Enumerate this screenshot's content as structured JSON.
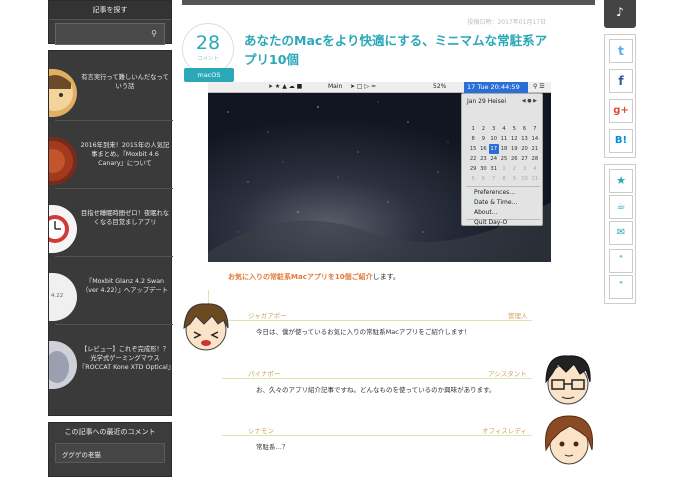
{
  "sidebar": {
    "search_title": "記事を探す",
    "articles": [
      {
        "title": "有言実行って難しいんだなっていう話"
      },
      {
        "title": "2016年到来！2015年の人気記事まとめ。『Moxbit 4.6 Canary』について"
      },
      {
        "title": "目指せ睡眠時間ゼロ！夜眠れなくなる目覚ましアプリ"
      },
      {
        "title": "『Moxbit Glanz 4.2 Swan（ver 4.22）』へアップデート",
        "thumb_label": "4.22"
      },
      {
        "title": "【レビュー】これぞ完成形！？光学式ゲーミングマウス『ROCCAT Kone XTD Optical』"
      }
    ],
    "comments_title": "この記事への最近のコメント",
    "comment_author": "ググゲの老猫"
  },
  "article": {
    "post_date": "投稿日時：2017年01月17日",
    "comment_count": "28",
    "comment_label": "コメント",
    "category": "macOS",
    "title": "あなたのMacをより快適にする、ミニマムな常駐系アプリ10個",
    "intro_highlight": "お気に入りの常駐系Macアプリを10個ご紹介",
    "intro_rest": "します。"
  },
  "screenshot": {
    "menu_main": "Main",
    "battery": "52%",
    "clock": "17 Tue 20:44:59",
    "cal_month": "Jan 29 Heisei",
    "cal_nav": "◀ ● ▶",
    "cal_rows": [
      [
        "",
        "",
        "",
        "",
        "",
        "",
        ""
      ],
      [
        "1",
        "2",
        "3",
        "4",
        "5",
        "6",
        "7"
      ],
      [
        "8",
        "9",
        "10",
        "11",
        "12",
        "13",
        "14"
      ],
      [
        "15",
        "16",
        "17",
        "18",
        "19",
        "20",
        "21"
      ],
      [
        "22",
        "23",
        "24",
        "25",
        "26",
        "27",
        "28"
      ],
      [
        "29",
        "30",
        "31",
        "1",
        "2",
        "3",
        "4"
      ],
      [
        "5",
        "6",
        "7",
        "8",
        "9",
        "10",
        "11"
      ]
    ],
    "menu_preferences": "Preferences...",
    "menu_datetime": "Date & Time...",
    "menu_about": "About...",
    "menu_quit": "Quit Day-O"
  },
  "dialogs": [
    {
      "speaker": "ジャガアポー",
      "role": "管理人",
      "message": "今日は、僕が使っているお気に入りの常駐系Macアプリをご紹介します！"
    },
    {
      "speaker": "パイナポー",
      "role": "アシスタント",
      "message": "お、久々のアプリ紹介記事ですね。どんなものを使っているのか興味があります。"
    },
    {
      "speaker": "シナモン",
      "role": "オフィスレディ",
      "message": "常駐系…？"
    }
  ],
  "social": {
    "twitter": "t",
    "facebook": "f",
    "gplus": "g+",
    "hatena": "B!"
  },
  "colors": {
    "accent": "#2aa8b8",
    "sidebar": "#3a3a3a",
    "highlight": "#e07b39"
  }
}
